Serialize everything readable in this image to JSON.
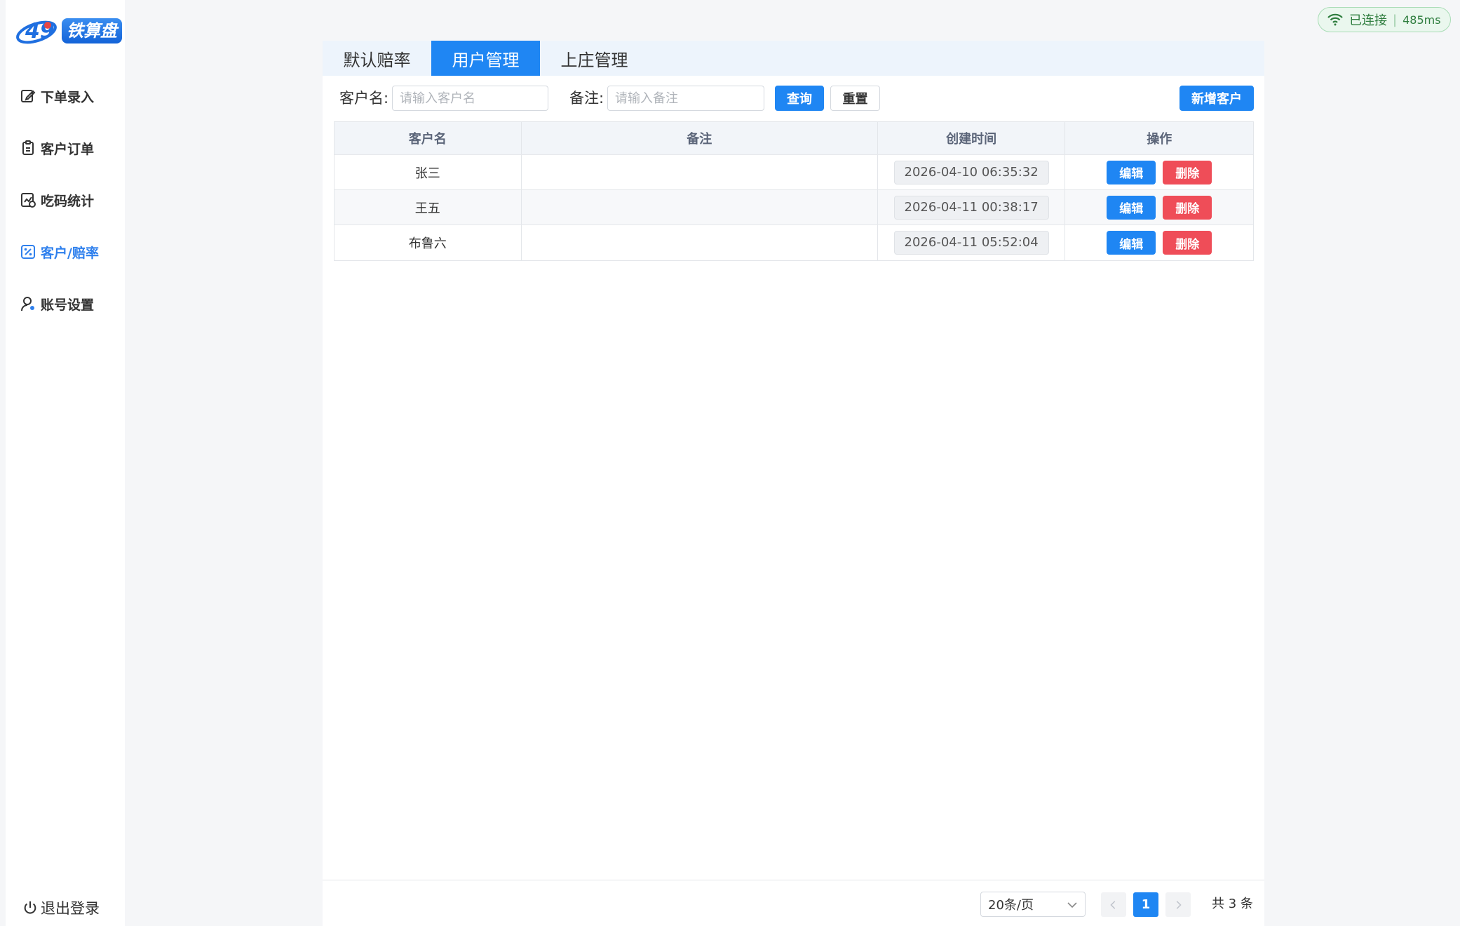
{
  "app": {
    "logo_text": "铁算盘",
    "logo_mark": "49"
  },
  "status": {
    "label": "已连接",
    "latency": "485ms",
    "color": "#2e7d3e"
  },
  "sidebar": {
    "items": [
      {
        "label": "下单录入",
        "icon": "edit-icon"
      },
      {
        "label": "客户订单",
        "icon": "clipboard-icon"
      },
      {
        "label": "吃码统计",
        "icon": "chart-icon"
      },
      {
        "label": "客户/赔率",
        "icon": "percent-icon",
        "active": true
      },
      {
        "label": "账号设置",
        "icon": "user-settings-icon"
      }
    ],
    "logout_label": "退出登录"
  },
  "tabs": [
    {
      "label": "默认赔率"
    },
    {
      "label": "用户管理",
      "active": true
    },
    {
      "label": "上庄管理"
    }
  ],
  "filter": {
    "name_label": "客户名:",
    "name_placeholder": "请输入客户名",
    "remark_label": "备注:",
    "remark_placeholder": "请输入备注",
    "query_label": "查询",
    "reset_label": "重置",
    "add_label": "新增客户"
  },
  "table": {
    "columns": [
      "客户名",
      "备注",
      "创建时间",
      "操作"
    ],
    "rows": [
      {
        "name": "张三",
        "remark": "",
        "created": "2026-04-10 06:35:32"
      },
      {
        "name": "王五",
        "remark": "",
        "created": "2026-04-11 00:38:17"
      },
      {
        "name": "布鲁六",
        "remark": "",
        "created": "2026-04-11 05:52:04"
      }
    ],
    "edit_label": "编辑",
    "delete_label": "删除"
  },
  "pagination": {
    "page_size": "20条/页",
    "current_page": "1",
    "total": "共 3 条"
  },
  "colors": {
    "primary": "#1f86f3",
    "danger": "#ef4d58",
    "active_nav": "#2f80ed"
  }
}
